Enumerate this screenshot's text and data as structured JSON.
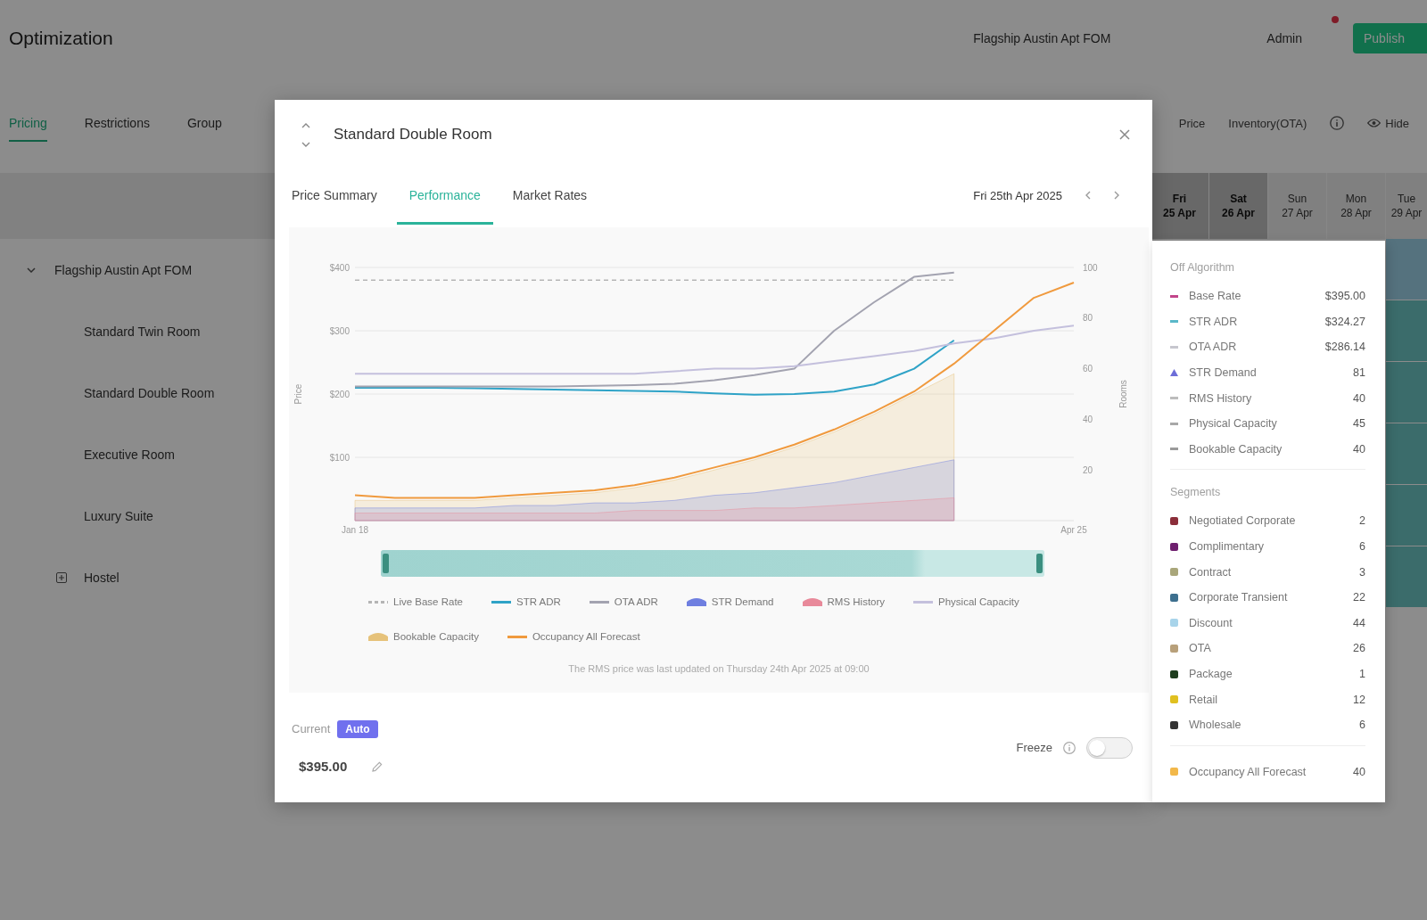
{
  "header": {
    "title": "Optimization",
    "property": "Flagship Austin Apt FOM",
    "user": "Admin",
    "notification": true,
    "action_button": "Publish"
  },
  "nav_tabs": [
    {
      "label": "Pricing",
      "selected": true
    },
    {
      "label": "Restrictions",
      "selected": false
    },
    {
      "label": "Group",
      "selected": false
    }
  ],
  "view_options": [
    "Price",
    "Inventory(OTA)"
  ],
  "hide_button": "Hide",
  "grid_columns": [
    {
      "day": "Fri",
      "date": "25 Apr",
      "weekend": true
    },
    {
      "day": "Sat",
      "date": "26 Apr",
      "weekend": true
    },
    {
      "day": "Sun",
      "date": "27 Apr",
      "weekend": false
    },
    {
      "day": "Mon",
      "date": "28 Apr",
      "weekend": false
    },
    {
      "day": "Tue",
      "date": "29 Apr",
      "weekend": false
    }
  ],
  "sidebar": {
    "tree": [
      {
        "label": "Flagship Austin Apt FOM",
        "expanded": true,
        "children": [
          {
            "label": "Standard Twin Room"
          },
          {
            "label": "Standard Double Room"
          },
          {
            "label": "Executive Room"
          },
          {
            "label": "Luxury Suite"
          },
          {
            "label": "Hostel",
            "expanded": false
          }
        ]
      }
    ]
  },
  "dialog": {
    "title": "Standard Double Room",
    "tabs": [
      {
        "label": "Price Summary",
        "selected": false
      },
      {
        "label": "Performance",
        "selected": true
      },
      {
        "label": "Market Rates",
        "selected": false
      }
    ],
    "date": "Fri 25th Apr 2025",
    "chart_data": {
      "type": "line",
      "ylabel": "Price",
      "y2label": "Rooms",
      "grid": true,
      "categories": [
        "Jan 18",
        null,
        null,
        null,
        null,
        null,
        null,
        null,
        null,
        null,
        null,
        null,
        null,
        null,
        null,
        null,
        null,
        null,
        "Apr 25"
      ],
      "ylim": [
        0,
        400
      ],
      "yticks": [
        {
          "value": 100,
          "label": "$100"
        },
        {
          "value": 200,
          "label": "$200"
        },
        {
          "value": 300,
          "label": "$300"
        },
        {
          "value": 400,
          "label": "$400"
        }
      ],
      "y2lim": [
        0,
        100
      ],
      "y2ticks": [
        20,
        40,
        60,
        80,
        100
      ],
      "series": [
        {
          "name": "Live Base Rate",
          "type": "line",
          "line_style": "dashed",
          "color": "#b5b5b5",
          "values": [
            380,
            380,
            380,
            380,
            380,
            380,
            380,
            380,
            380,
            380,
            380,
            380,
            380,
            380,
            380,
            380,
            null,
            null,
            null
          ]
        },
        {
          "name": "STR ADR",
          "type": "line",
          "color": "#2fa3c7",
          "values": [
            210,
            210,
            210,
            209,
            208,
            207,
            206,
            205,
            204,
            201,
            199,
            200,
            204,
            215,
            240,
            285,
            null,
            null,
            null
          ]
        },
        {
          "name": "OTA ADR",
          "type": "line",
          "color": "#a3a3b0",
          "values": [
            212,
            212,
            212,
            212,
            212,
            212,
            213,
            214,
            216,
            222,
            230,
            240,
            300,
            345,
            385,
            392,
            null,
            null,
            null
          ]
        },
        {
          "name": "STR Demand",
          "type": "area",
          "axis": "y2",
          "color": "#6f7fe0",
          "values": [
            5,
            5,
            5,
            5,
            6,
            6,
            7,
            7,
            8,
            10,
            11,
            13,
            15,
            18,
            21,
            24,
            null,
            null,
            null
          ]
        },
        {
          "name": "RMS History",
          "type": "area",
          "axis": "y2",
          "color": "#e8899a",
          "values": [
            3,
            3,
            3,
            3,
            3,
            3,
            3,
            4,
            4,
            4,
            5,
            5,
            6,
            7,
            8,
            9,
            null,
            null,
            null
          ]
        },
        {
          "name": "Physical Capacity",
          "type": "line",
          "axis": "y2",
          "color": "#c4c0dd",
          "values": [
            58,
            58,
            58,
            58,
            58,
            58,
            58,
            58,
            59,
            60,
            60,
            61,
            63,
            65,
            67,
            70,
            72,
            75,
            77
          ]
        },
        {
          "name": "Bookable Capacity",
          "type": "area",
          "axis": "y2",
          "color": "#e6c27a",
          "values": [
            8,
            8,
            8,
            8,
            9,
            10,
            11,
            13,
            16,
            20,
            24,
            29,
            35,
            42,
            50,
            58,
            null,
            null,
            null
          ]
        },
        {
          "name": "Occupancy All Forecast",
          "type": "line",
          "axis": "y2",
          "color": "#f09a3e",
          "values": [
            10,
            9,
            9,
            9,
            10,
            11,
            12,
            14,
            17,
            21,
            25,
            30,
            36,
            43,
            51,
            62,
            75,
            88,
            94
          ]
        }
      ]
    },
    "zoom_slider": {
      "level": 1
    },
    "note": "The RMS price was last updated on Thursday 24th Apr 2025 at 09:00",
    "current": {
      "label": "Current",
      "badge": "Auto",
      "price": "$395.00"
    },
    "freeze": {
      "label": "Freeze",
      "on": false
    }
  },
  "details_panel": {
    "sections": [
      {
        "title": "Off Algorithm",
        "items": [
          {
            "label": "Base Rate",
            "value": "$395.00",
            "kind": "line",
            "color": "#c2458a"
          },
          {
            "label": "STR ADR",
            "value": "$324.27",
            "kind": "line",
            "color": "#5ab8c9"
          },
          {
            "label": "OTA ADR",
            "value": "$286.14",
            "kind": "line",
            "color": "#c6c6ce"
          },
          {
            "label": "STR Demand",
            "value": "81",
            "kind": "area",
            "color": "#6d6ed8"
          },
          {
            "label": "RMS History",
            "value": "40",
            "kind": "line",
            "color": "#bcbcbc"
          },
          {
            "label": "Physical Capacity",
            "value": "45",
            "kind": "line",
            "color": "#a8a8a8"
          },
          {
            "label": "Bookable Capacity",
            "value": "40",
            "kind": "line",
            "color": "#9a9a9a"
          }
        ]
      },
      {
        "title": "Segments",
        "items": [
          {
            "label": "Negotiated Corporate",
            "value": "2",
            "kind": "square",
            "color": "#8b2e3a"
          },
          {
            "label": "Complimentary",
            "value": "6",
            "kind": "square",
            "color": "#6e1f6e"
          },
          {
            "label": "Contract",
            "value": "3",
            "kind": "square",
            "color": "#a9a67a"
          },
          {
            "label": "Corporate Transient",
            "value": "22",
            "kind": "square",
            "color": "#3d6f8e"
          },
          {
            "label": "Discount",
            "value": "44",
            "kind": "square",
            "color": "#a8d4ea"
          },
          {
            "label": "OTA",
            "value": "26",
            "kind": "square",
            "color": "#b8a07a"
          },
          {
            "label": "Package",
            "value": "1",
            "kind": "square",
            "color": "#1e3d1e"
          },
          {
            "label": "Retail",
            "value": "12",
            "kind": "square",
            "color": "#e0c020"
          },
          {
            "label": "Wholesale",
            "value": "6",
            "kind": "square",
            "color": "#333333"
          }
        ]
      },
      {
        "items": [
          {
            "label": "Occupancy All Forecast",
            "value": "40",
            "kind": "square",
            "color": "#f2b84a"
          }
        ]
      }
    ]
  }
}
